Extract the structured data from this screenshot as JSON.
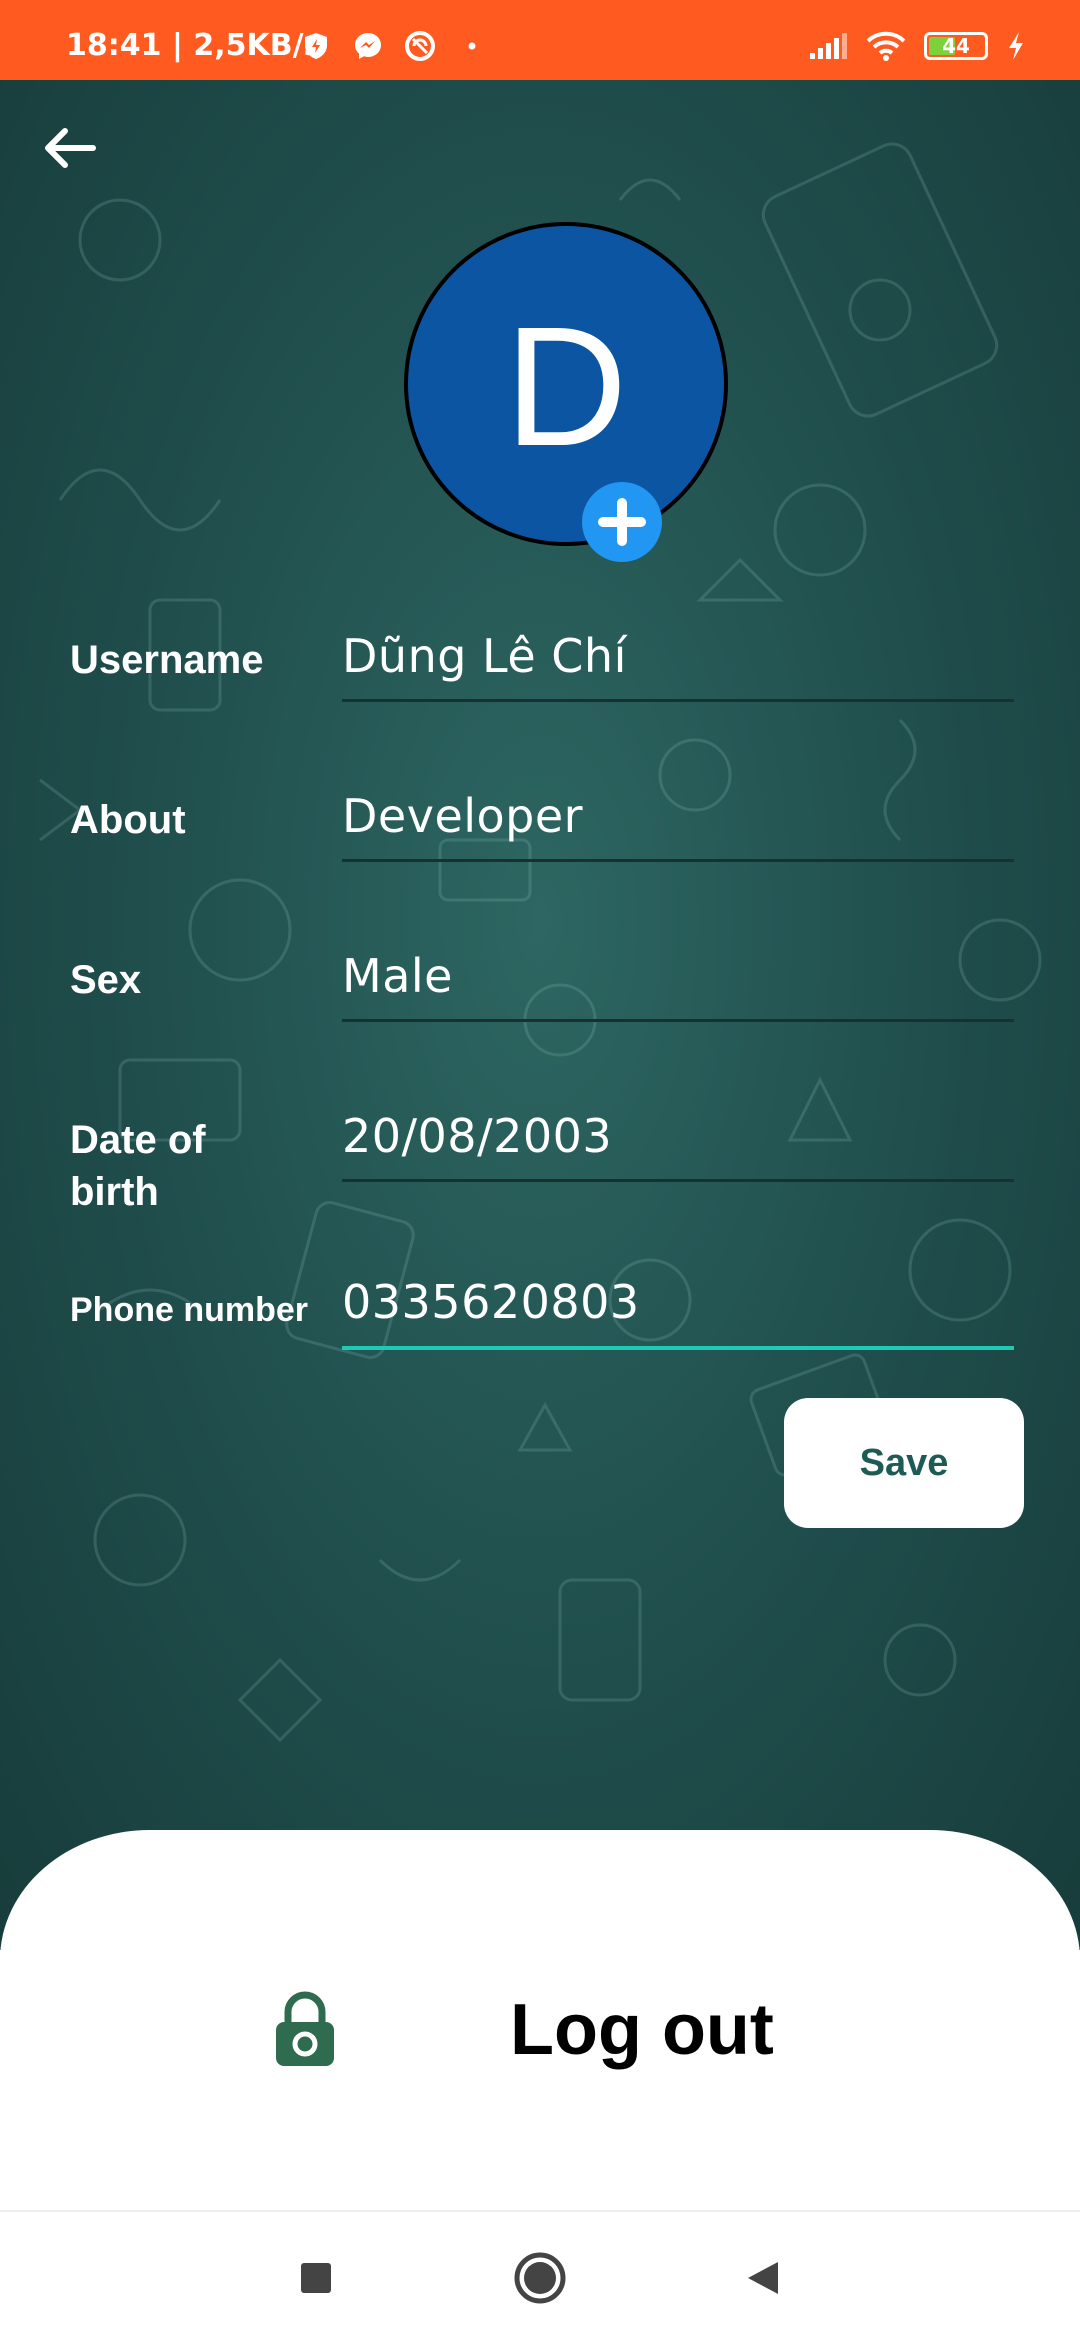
{
  "status_bar": {
    "time": "18:41",
    "speed": "| 2,5KB/s",
    "battery": "44",
    "icons": [
      "shield-icon",
      "messenger-icon",
      "sync-icon",
      "dot-icon",
      "signal-icon",
      "wifi-icon",
      "battery-icon",
      "charging-icon"
    ]
  },
  "profile": {
    "avatar_letter": "D",
    "avatar_color": "#0b55a3"
  },
  "form": {
    "fields": [
      {
        "label": "Username",
        "value": "Dũng Lê Chí"
      },
      {
        "label": "About",
        "value": "Developer"
      },
      {
        "label": "Sex",
        "value": "Male"
      },
      {
        "label": "Date of birth",
        "value": "20/08/2003"
      },
      {
        "label": "Phone number",
        "value": "0335620803"
      }
    ],
    "save_label": "Save"
  },
  "logout": {
    "label": "Log out"
  },
  "colors": {
    "status_bar": "#ff5a1f",
    "background": "#1f4d4b",
    "accent": "#1fc9b6",
    "add_button": "#2196f3",
    "lock_icon": "#2e6b4f"
  }
}
